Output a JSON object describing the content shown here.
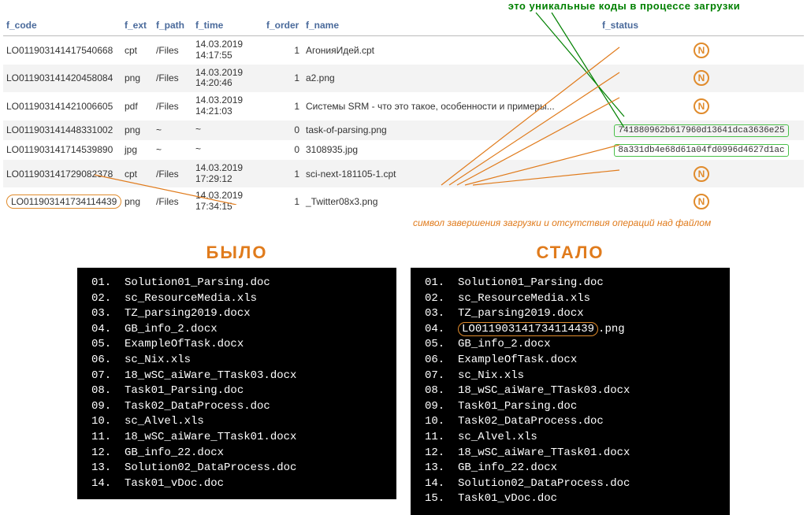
{
  "annotations": {
    "top": "это уникальные коды в процессе загрузки",
    "mid": "символ завершения загрузки и отсутствия операций над файлом"
  },
  "table": {
    "headers": {
      "f_code": "f_code",
      "f_ext": "f_ext",
      "f_path": "f_path",
      "f_time": "f_time",
      "f_order": "f_order",
      "f_name": "f_name",
      "f_status": "f_status"
    },
    "rows": [
      {
        "f_code": "LO011903141417540668",
        "f_ext": "cpt",
        "f_path": "/Files",
        "f_time_date": "14.03.2019",
        "f_time_time": "14:17:55",
        "f_order": "1",
        "f_name": "АгонияИдей.cpt",
        "status_type": "N",
        "status_text": "N"
      },
      {
        "f_code": "LO011903141420458084",
        "f_ext": "png",
        "f_path": "/Files",
        "f_time_date": "14.03.2019",
        "f_time_time": "14:20:46",
        "f_order": "1",
        "f_name": "a2.png",
        "status_type": "N",
        "status_text": "N"
      },
      {
        "f_code": "LO011903141421006605",
        "f_ext": "pdf",
        "f_path": "/Files",
        "f_time_date": "14.03.2019",
        "f_time_time": "14:21:03",
        "f_order": "1",
        "f_name": "Системы SRM - что это такое, особенности и примеры...",
        "status_type": "N",
        "status_text": "N"
      },
      {
        "f_code": "LO011903141448331002",
        "f_ext": "png",
        "f_path": "~",
        "f_time_date": "~",
        "f_time_time": "",
        "f_order": "0",
        "f_name": "task-of-parsing.png",
        "status_type": "hash",
        "status_text": "741880962b617960d13641dca3636e25"
      },
      {
        "f_code": "LO011903141714539890",
        "f_ext": "jpg",
        "f_path": "~",
        "f_time_date": "~",
        "f_time_time": "",
        "f_order": "0",
        "f_name": "3108935.jpg",
        "status_type": "hash",
        "status_text": "8a331db4e68d61a04fd0996d4627d1ac"
      },
      {
        "f_code": "LO011903141729082378",
        "f_ext": "cpt",
        "f_path": "/Files",
        "f_time_date": "14.03.2019",
        "f_time_time": "17:29:12",
        "f_order": "1",
        "f_name": "sci-next-181105-1.cpt",
        "status_type": "N",
        "status_text": "N"
      },
      {
        "f_code": "LO011903141734114439",
        "f_ext": "png",
        "f_path": "/Files",
        "f_time_date": "14.03.2019",
        "f_time_time": "17:34:15",
        "f_order": "1",
        "f_name": "_Twitter08x3.png",
        "status_type": "N",
        "status_text": "N"
      }
    ]
  },
  "compare": {
    "left_title": "БЫЛО",
    "right_title": "СТАЛО",
    "left": [
      {
        "num": "01.",
        "name": "Solution01_Parsing.doc"
      },
      {
        "num": "02.",
        "name": "sc_ResourceMedia.xls"
      },
      {
        "num": "03.",
        "name": "TZ_parsing2019.docx"
      },
      {
        "num": "04.",
        "name": "GB_info_2.docx"
      },
      {
        "num": "05.",
        "name": "ExampleOfTask.docx"
      },
      {
        "num": "06.",
        "name": "sc_Nix.xls"
      },
      {
        "num": "07.",
        "name": "18_wSC_aiWare_TTask03.docx"
      },
      {
        "num": "08.",
        "name": "Task01_Parsing.doc"
      },
      {
        "num": "09.",
        "name": "Task02_DataProcess.doc"
      },
      {
        "num": "10.",
        "name": "sc_Alvel.xls"
      },
      {
        "num": "11.",
        "name": "18_wSC_aiWare_TTask01.docx"
      },
      {
        "num": "12.",
        "name": "GB_info_22.docx"
      },
      {
        "num": "13.",
        "name": "Solution02_DataProcess.doc"
      },
      {
        "num": "14.",
        "name": "Task01_vDoc.doc"
      }
    ],
    "right": [
      {
        "num": "01.",
        "name": "Solution01_Parsing.doc"
      },
      {
        "num": "02.",
        "name": "sc_ResourceMedia.xls"
      },
      {
        "num": "03.",
        "name": "TZ_parsing2019.docx"
      },
      {
        "num": "04.",
        "name_pre": "LO011903141734114439",
        "name_post": ".png",
        "hl": true
      },
      {
        "num": "05.",
        "name": "GB_info_2.docx"
      },
      {
        "num": "06.",
        "name": "ExampleOfTask.docx"
      },
      {
        "num": "07.",
        "name": "sc_Nix.xls"
      },
      {
        "num": "08.",
        "name": "18_wSC_aiWare_TTask03.docx"
      },
      {
        "num": "09.",
        "name": "Task01_Parsing.doc"
      },
      {
        "num": "10.",
        "name": "Task02_DataProcess.doc"
      },
      {
        "num": "11.",
        "name": "sc_Alvel.xls"
      },
      {
        "num": "12.",
        "name": "18_wSC_aiWare_TTask01.docx"
      },
      {
        "num": "13.",
        "name": "GB_info_22.docx"
      },
      {
        "num": "14.",
        "name": "Solution02_DataProcess.doc"
      },
      {
        "num": "15.",
        "name": "Task01_vDoc.doc"
      }
    ]
  }
}
